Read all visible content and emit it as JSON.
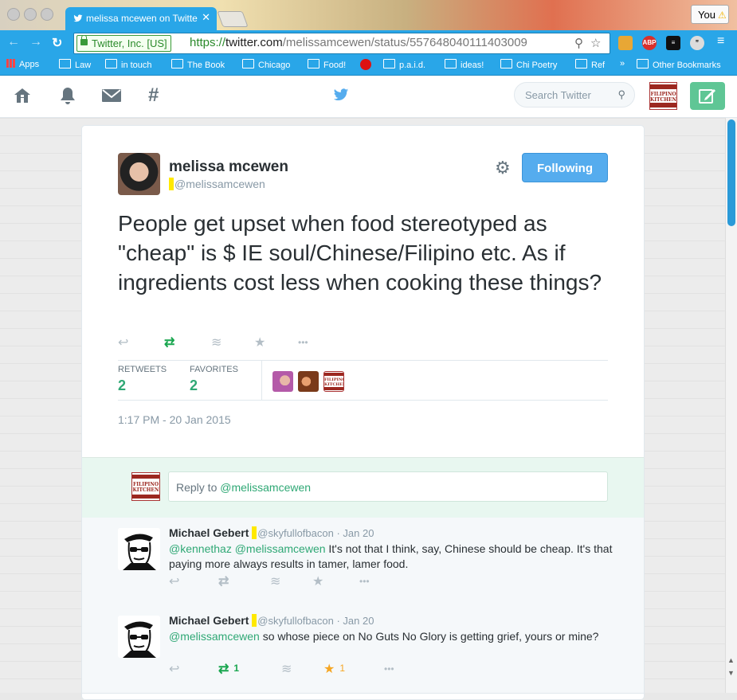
{
  "browser": {
    "tab_title": "melissa mcewen on Twitte",
    "profile_label": "You",
    "secure_label": "Twitter, Inc. [US]",
    "url_scheme": "https://",
    "url_host": "twitter.com",
    "url_path": "/melissamcewen/status/557648040111403009",
    "bookmarks": [
      {
        "label": "Apps"
      },
      {
        "label": "Law"
      },
      {
        "label": "in touch"
      },
      {
        "label": "The Book"
      },
      {
        "label": "Chicago"
      },
      {
        "label": "Food!"
      },
      {
        "label": "p.a.i.d."
      },
      {
        "label": "ideas!"
      },
      {
        "label": "Chi Poetry"
      },
      {
        "label": "Ref"
      },
      {
        "label": "»"
      },
      {
        "label": "Other Bookmarks"
      }
    ],
    "ext_abp": "ABP"
  },
  "header": {
    "search_placeholder": "Search Twitter",
    "avatar_text_1": "FILIPINO",
    "avatar_text_2": "KITCHEN"
  },
  "tweet": {
    "name": "melissa mcewen",
    "handle": "@melissamcewen",
    "follow_label": "Following",
    "text": "People get upset when food stereotyped as \"cheap\" is $ IE soul/Chinese/Filipino etc. As if ingredients cost less when cooking these things?",
    "retweets_label": "RETWEETS",
    "retweets_count": "2",
    "favorites_label": "FAVORITES",
    "favorites_count": "2",
    "timestamp": "1:17 PM - 20 Jan 2015",
    "more_label": "•••"
  },
  "reply_box": {
    "prefix": "Reply to ",
    "mention": "@melissamcewen"
  },
  "replies": [
    {
      "name": "Michael Gebert",
      "handle": "@skyfullofbacon",
      "date": " · Jan 20",
      "mention_1": "@kennethaz",
      "mention_2": " @melissamcewen",
      "text": " It's not that I think, say, Chinese should be cheap. It's that paying more always results in tamer, lamer food.",
      "retweet_count": "",
      "favorite_count": ""
    },
    {
      "name": "Michael Gebert",
      "handle": "@skyfullofbacon",
      "date": " · Jan 20",
      "mention_1": "@melissamcewen",
      "mention_2": "",
      "text": " so whose piece on No Guts No Glory is getting grief, yours or mine?",
      "retweet_count": "1",
      "favorite_count": "1"
    }
  ]
}
